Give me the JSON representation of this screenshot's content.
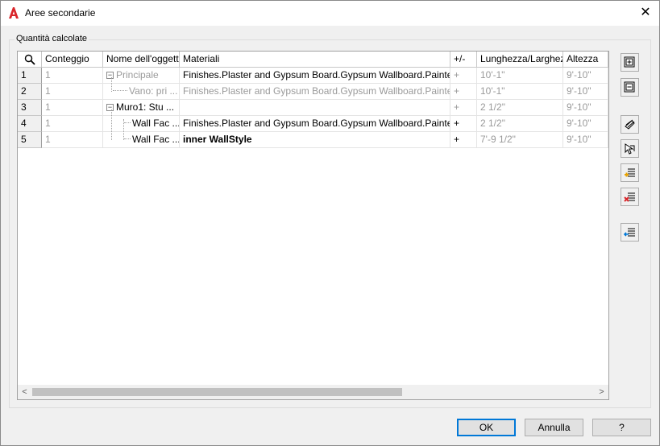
{
  "window": {
    "title": "Aree secondarie",
    "close_glyph": "✕"
  },
  "group": {
    "legend": "Quantità calcolate"
  },
  "table": {
    "headers": [
      "Conteggio",
      "Nome dell'oggetto",
      "Materiali",
      "+/-",
      "Lunghezza/Larghezza",
      "Altezza"
    ],
    "rows": [
      {
        "num": "1",
        "count": "1",
        "name": "Principale",
        "material": "Finishes.Plaster and Gypsum Board.Gypsum Wallboard.Painted",
        "plusminus": "+",
        "length": "10'-1\"",
        "height": "9'-10\""
      },
      {
        "num": "2",
        "count": "1",
        "name": "Vano: pri ...",
        "material": "Finishes.Plaster and Gypsum Board.Gypsum Wallboard.Painted",
        "plusminus": "+",
        "length": "10'-1\"",
        "height": "9'-10\""
      },
      {
        "num": "3",
        "count": "1",
        "name": "Muro1: Stu ...",
        "material": "",
        "plusminus": "+",
        "length": "2 1/2\"",
        "height": "9'-10\""
      },
      {
        "num": "4",
        "count": "1",
        "name": "Wall Fac ...",
        "material": "Finishes.Plaster and Gypsum Board.Gypsum Wallboard.Painted",
        "plusminus": "+",
        "length": "2 1/2\"",
        "height": "9'-10\""
      },
      {
        "num": "5",
        "count": "1",
        "name": "Wall Fac ...",
        "material": "inner WallStyle",
        "plusminus": "+",
        "length": "7'-9 1/2\"",
        "height": "9'-10\""
      }
    ]
  },
  "scroll": {
    "left_arrow": "<",
    "right_arrow": ">"
  },
  "buttons": {
    "ok": "OK",
    "cancel": "Annulla",
    "help": "?"
  },
  "icons": {
    "app": "autocad-a-icon",
    "magnifier": "search-icon",
    "tools": [
      "add-subarea-icon",
      "subtract-subarea-icon",
      "select-object-icon",
      "pick-objects-icon",
      "add-row-icon",
      "remove-row-icon",
      "import-row-icon"
    ]
  },
  "colors": {
    "accent": "#0078d7",
    "app_icon": "#d9262b",
    "gray_text": "#9a9a9a"
  }
}
